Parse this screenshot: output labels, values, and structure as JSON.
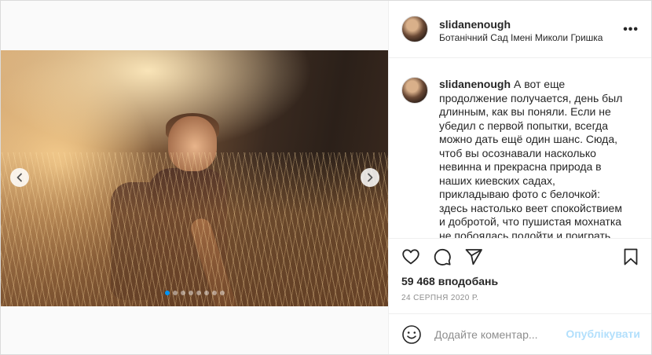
{
  "post": {
    "username": "slidanenough",
    "location": "Ботанічний Сад Імені Миколи Гришка",
    "more_label": "•••",
    "caption": "А вот еще продолжение получается, день был длинным, как вы поняли. Если не убедил с первой попытки, всегда можно дать ещё один шанс. Сюда, чтоб вы осознавали насколько невинна и прекрасна природа в наших киевских садах, прикладываю фото с белочкой: здесь настолько веет спокойствием и добротой, что пушистая мохнатка не побоялась подойти и поиграть",
    "likes": "59 468 вподобань",
    "date": "24 СЕРПНЯ 2020 Р."
  },
  "carousel": {
    "dot_count": 8,
    "active_index": 0
  },
  "comment": {
    "placeholder": "Додайте коментар...",
    "publish_label": "Опублікувати"
  },
  "icons": {
    "prev": "chevron-left-icon",
    "next": "chevron-right-icon",
    "like": "heart-icon",
    "comment": "comment-icon",
    "share": "paper-plane-icon",
    "save": "bookmark-icon",
    "emoji": "emoji-smile-icon",
    "more": "more-dots-icon"
  },
  "colors": {
    "accent": "#0095f6",
    "publish_disabled": "#b2dffc",
    "text": "#262626",
    "muted": "#8e8e8e"
  }
}
